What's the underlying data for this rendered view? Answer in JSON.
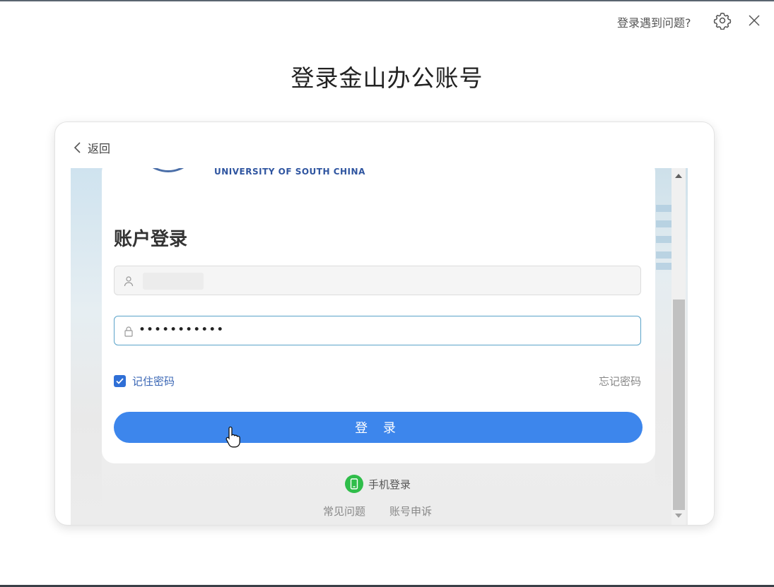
{
  "header": {
    "help_link": "登录遇到问题?",
    "title": "登录金山办公账号"
  },
  "panel": {
    "back_label": "返回"
  },
  "webview": {
    "university_name": "UNIVERSITY OF SOUTH CHINA",
    "form_title": "账户登录",
    "username_value": "",
    "password_value": "•••••••••••",
    "remember_label": "记住密码",
    "remember_checked": true,
    "forgot_label": "忘记密码",
    "login_button": "登 录",
    "phone_login_label": "手机登录",
    "faq_label": "常见问题",
    "appeal_label": "账号申诉"
  },
  "colors": {
    "primary_button": "#3d86ec",
    "checkbox": "#2f6fd6",
    "phone_icon": "#2fbd4a",
    "focused_border": "#5aa3c9"
  },
  "icons": [
    "gear-icon",
    "close-icon",
    "chevron-left-icon",
    "user-icon",
    "lock-icon",
    "check-icon",
    "phone-icon",
    "scroll-up-icon",
    "scroll-down-icon",
    "pointer-cursor-icon"
  ]
}
